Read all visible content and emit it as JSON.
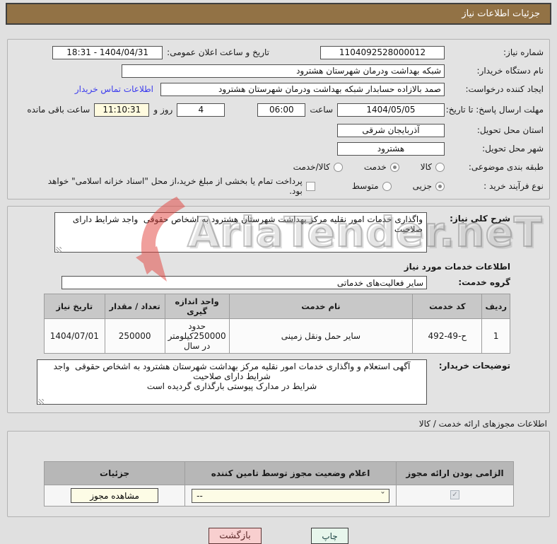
{
  "header": {
    "title": "جزئیات اطلاعات نیاز"
  },
  "form": {
    "need_number": {
      "label": "شماره نیاز:",
      "value": "1104092528000012"
    },
    "announce": {
      "label": "تاریخ و ساعت اعلان عمومی:",
      "value": "1404/04/31 - 18:31"
    },
    "buyer_org": {
      "label": "نام دستگاه خریدار:",
      "value": "شبکه بهداشت ودرمان شهرستان هشترود"
    },
    "request_creator": {
      "label": "ایجاد کننده درخواست:",
      "value": "صمد بالازاده حسابدار شبکه بهداشت ودرمان شهرستان هشترود"
    },
    "contact_link": "اطلاعات تماس خریدار",
    "deadline": {
      "label": "مهلت ارسال پاسخ: تا تاریخ:",
      "date": "1404/05/05",
      "hour_label": "ساعت",
      "hour": "06:00"
    },
    "remaining": {
      "days": "4",
      "days_label": "روز و",
      "time": "11:10:31",
      "suffix": "ساعت باقی مانده"
    },
    "province": {
      "label": "استان محل تحویل:",
      "value": "آذربایجان شرقی"
    },
    "city": {
      "label": "شهر محل تحویل:",
      "value": "هشترود"
    },
    "classification": {
      "label": "طبقه بندی موضوعی:",
      "options": [
        {
          "label": "کالا",
          "checked": false
        },
        {
          "label": "خدمت",
          "checked": true
        },
        {
          "label": "کالا/خدمت",
          "checked": false
        }
      ]
    },
    "process_type": {
      "label": "نوع فرآیند خرید :",
      "options": [
        {
          "label": "جزیی",
          "checked": true
        },
        {
          "label": "متوسط",
          "checked": false
        }
      ],
      "checkbox_checked": false,
      "checkbox_label": "پرداخت تمام یا بخشی از مبلغ خرید،از محل \"اسناد خزانه اسلامی\" خواهد بود."
    }
  },
  "need_desc": {
    "label": "شرح کلی نیاز:",
    "value": "واگذاری خدمات امور نقلیه مرکز بهداشت شهرستان هشترود به اشخاص حقوقی  واجد شرایط دارای صلاحیت"
  },
  "services_section": {
    "title": "اطلاعات خدمات مورد نیاز",
    "group": {
      "label": "گروه خدمت:",
      "value": "سایر فعالیت‌های خدماتی"
    },
    "table": {
      "headers": [
        "ردیف",
        "کد خدمت",
        "نام خدمت",
        "واحد اندازه گیری",
        "تعداد / مقدار",
        "تاریخ نیاز"
      ],
      "rows": [
        [
          "1",
          "ح-49‏-492",
          "سایر حمل ونقل زمینی",
          "حدود 250000کیلومتر در سال",
          "250000",
          "1404/07/01"
        ]
      ]
    }
  },
  "buyer_notes": {
    "label": "توضیحات خریدار:",
    "value": "آگهی استعلام و واگذاری خدمات امور نقلیه مرکز بهداشت شهرستان هشترود به اشخاص حقوقی  واجد شرایط دارای صلاحیت\nشرایط در مدارک پیوستی بارگذاری گردیده است"
  },
  "license_section": {
    "title": "اطلاعات مجوزهای ارائه خدمت / کالا",
    "table": {
      "headers": [
        "الزامی بودن ارائه مجوز",
        "اعلام وضعیت مجوز توسط تامین کننده",
        "جزئیات"
      ],
      "row": {
        "mandatory_checked": true,
        "status_value": "--",
        "details_button": "مشاهده مجوز"
      }
    }
  },
  "footer": {
    "print": "چاپ",
    "back": "بازگشت"
  },
  "watermark": {
    "text": "AriaTender.neT"
  },
  "colors": {
    "header_bg": "#927245",
    "page_bg": "#e0e0e0",
    "highlight_yellow": "#fffbdf",
    "link_blue": "#3a3aee",
    "back_btn_bg": "#f8cfcf",
    "print_btn_bg": "#e7f6ec",
    "watermark_red": "#e2413c"
  }
}
